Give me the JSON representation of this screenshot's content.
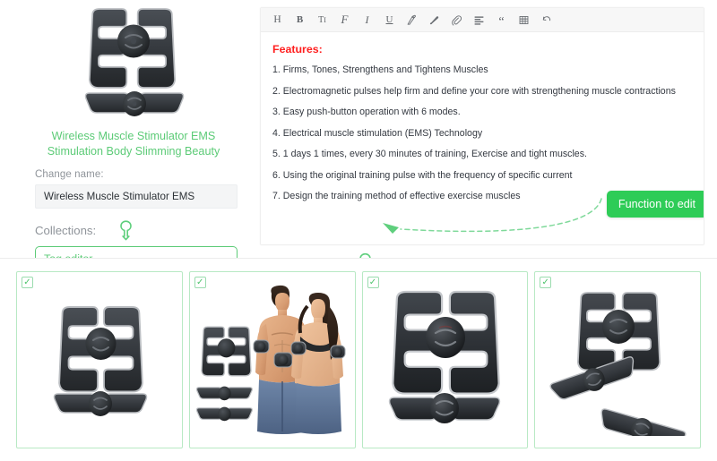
{
  "product": {
    "title": "Wireless Muscle Stimulator EMS Stimulation Body Slimming Beauty",
    "title_line1": "Wireless Muscle Stimulator EMS",
    "title_line2": "Stimulation Body Slimming Beauty",
    "hero_image_alt": "EMS abdominal muscle stimulator pads"
  },
  "form": {
    "change_name_label": "Change name:",
    "name_value": "Wireless Muscle Stimulator EMS",
    "name_placeholder": "Wireless Muscle Stimulator EMS",
    "collections_label": "Collections:",
    "tag_editor_value": "Tag editor",
    "tag_editor_placeholder": "Tag editor"
  },
  "editor": {
    "toolbar": [
      {
        "name": "heading-icon",
        "glyph": "H",
        "title": "Heading"
      },
      {
        "name": "bold-icon",
        "glyph": "B",
        "title": "Bold"
      },
      {
        "name": "font-size-icon",
        "glyph": "TI",
        "title": "Font size"
      },
      {
        "name": "font-family-icon",
        "glyph": "F",
        "title": "Font family"
      },
      {
        "name": "italic-icon",
        "glyph": "I",
        "title": "Italic"
      },
      {
        "name": "underline-icon",
        "glyph": "U",
        "title": "Underline"
      },
      {
        "name": "highlighter-icon",
        "glyph": "",
        "title": "Highlight"
      },
      {
        "name": "brush-icon",
        "glyph": "",
        "title": "Text color"
      },
      {
        "name": "link-icon",
        "glyph": "",
        "title": "Insert link"
      },
      {
        "name": "align-left-icon",
        "glyph": "",
        "title": "Align left"
      },
      {
        "name": "quote-icon",
        "glyph": "“",
        "title": "Block quote"
      },
      {
        "name": "table-icon",
        "glyph": "",
        "title": "Insert table"
      },
      {
        "name": "undo-icon",
        "glyph": "",
        "title": "Undo"
      }
    ],
    "features_heading": "Features:",
    "features": [
      "1. Firms, Tones, Strengthens and Tightens Muscles",
      "2. Electromagnetic pulses help firm and define your core with strengthening muscle contractions",
      "3. Easy push-button operation with 6 modes.",
      "4. Electrical muscle stimulation (EMS) Technology",
      "5. 1 days 1 times, every 30 minutes of training, Exercise and tight muscles.",
      "6. Using the original training pulse with the frequency of specific current",
      "7. Design the training method of effective exercise muscles"
    ],
    "callout_label": "Function to edit"
  },
  "gallery": {
    "cards": [
      {
        "name": "gallery-card-1",
        "checked": true,
        "art": "abs-plus-belt",
        "alt": "EMS abs pad and belt pad"
      },
      {
        "name": "gallery-card-2",
        "checked": true,
        "art": "lifestyle-couple",
        "alt": "Couple wearing EMS pads with product set"
      },
      {
        "name": "gallery-card-3",
        "checked": true,
        "art": "abs-plus-belt-large",
        "alt": "Large EMS abs pad and belt pad"
      },
      {
        "name": "gallery-card-4",
        "checked": true,
        "art": "abs-plus-two-arms",
        "alt": "EMS abs pad with two arm pads"
      }
    ],
    "check_glyph": "✓"
  },
  "colors": {
    "brand_green": "#5ccb77",
    "button_green": "#2ecc57",
    "heading_red": "#ff1f1f",
    "label_gray": "#8f949a",
    "card_border": "#b8e9c4"
  }
}
